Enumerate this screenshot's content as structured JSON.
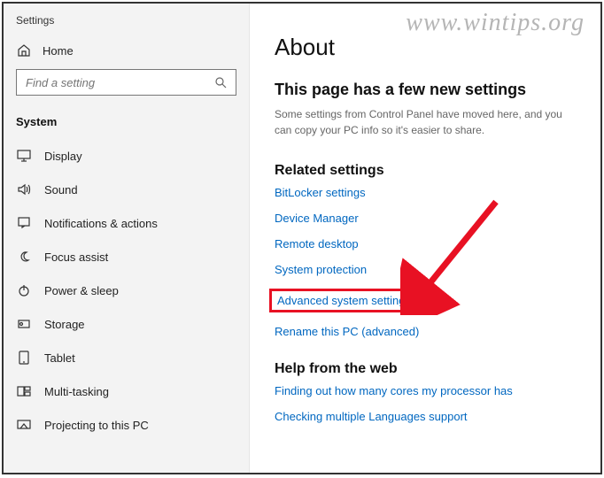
{
  "watermark": "www.wintips.org",
  "app_title": "Settings",
  "home_label": "Home",
  "search_placeholder": "Find a setting",
  "category": "System",
  "nav": [
    {
      "label": "Display",
      "icon": "display"
    },
    {
      "label": "Sound",
      "icon": "sound"
    },
    {
      "label": "Notifications & actions",
      "icon": "notifications"
    },
    {
      "label": "Focus assist",
      "icon": "focus"
    },
    {
      "label": "Power & sleep",
      "icon": "power"
    },
    {
      "label": "Storage",
      "icon": "storage"
    },
    {
      "label": "Tablet",
      "icon": "tablet"
    },
    {
      "label": "Multi-tasking",
      "icon": "multitask"
    },
    {
      "label": "Projecting to this PC",
      "icon": "projecting"
    }
  ],
  "page": {
    "title": "About",
    "subtitle": "This page has a few new settings",
    "description": "Some settings from Control Panel have moved here, and you can copy your PC info so it's easier to share."
  },
  "related": {
    "heading": "Related settings",
    "links": [
      "BitLocker settings",
      "Device Manager",
      "Remote desktop",
      "System protection",
      "Advanced system settings",
      "Rename this PC (advanced)"
    ],
    "highlight_index": 4
  },
  "help": {
    "heading": "Help from the web",
    "links": [
      "Finding out how many cores my processor has",
      "Checking multiple Languages support"
    ]
  }
}
